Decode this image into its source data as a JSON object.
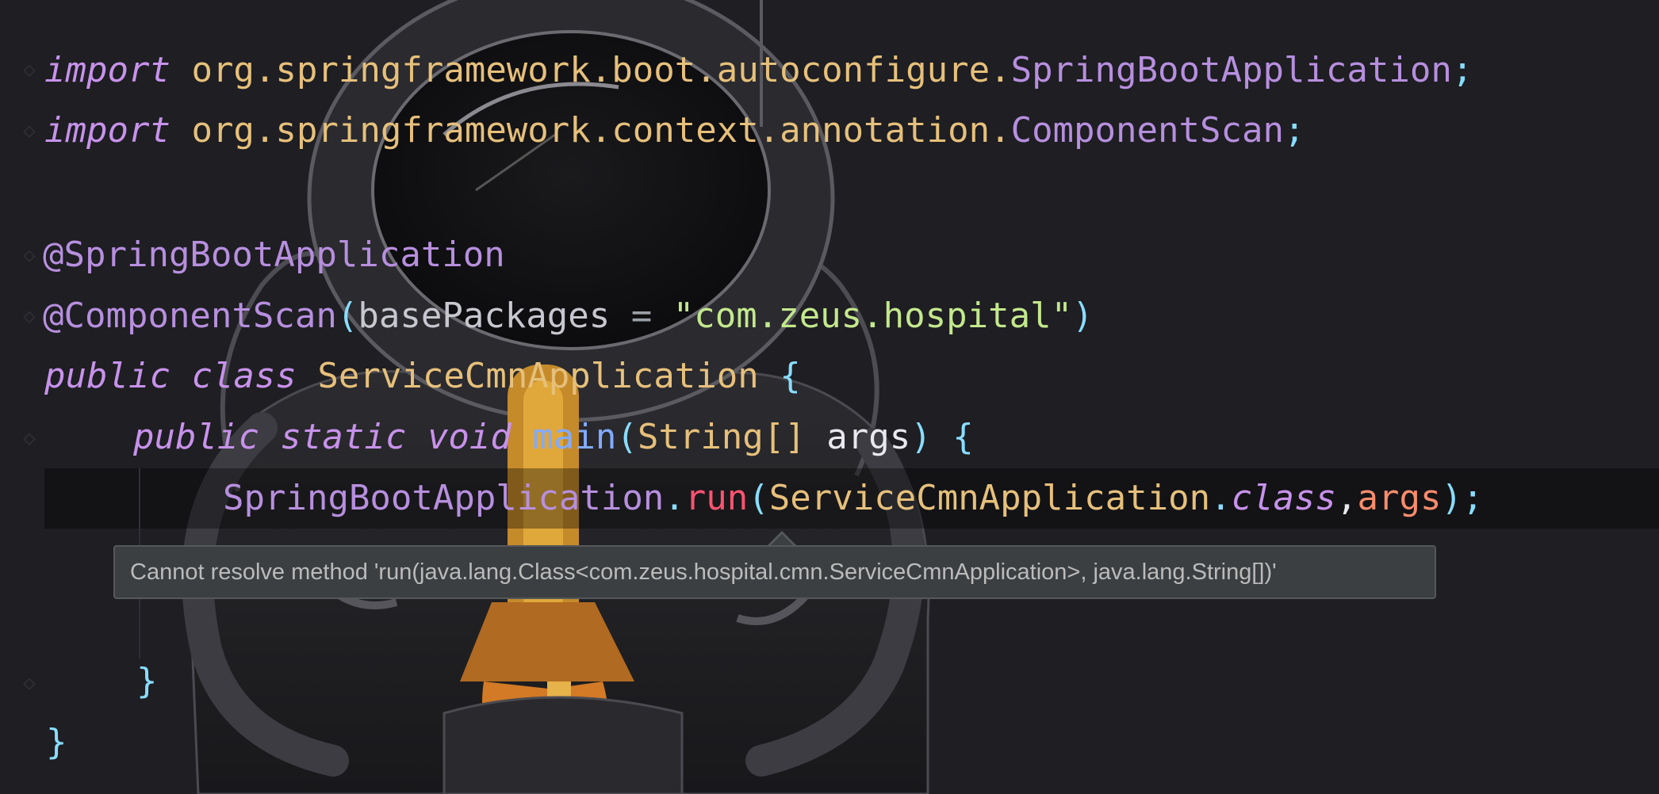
{
  "editor": {
    "language": "java",
    "background_color": "#1e1e23",
    "background_image": "astronaut-holding-rocket-artwork",
    "lines": {
      "l1": {
        "kw": "import",
        "pkg": "org.springframework.boot.autoconfigure.",
        "cls": "SpringBootApplication",
        "end": ";"
      },
      "l2": {
        "kw": "import",
        "pkg": "org.springframework.context.annotation.",
        "cls": "ComponentScan",
        "end": ";"
      },
      "l4": {
        "ann": "@SpringBootApplication"
      },
      "l5": {
        "ann": "@ComponentScan",
        "open": "(",
        "param": "basePackages",
        "eq": " = ",
        "str": "\"com.zeus.hospital\"",
        "close": ")"
      },
      "l6": {
        "kw1": "public",
        "kw2": "class",
        "cls": "ServiceCmnApplication",
        "brace": "{"
      },
      "l7": {
        "kw1": "public",
        "kw2": "static",
        "kw3": "void",
        "meth": "main",
        "open": "(",
        "type": "String[]",
        "param": "args",
        "close": ")",
        "brace": "{"
      },
      "l8": {
        "cls": "SpringBootApplication",
        "dot": ".",
        "meth": "run",
        "open": "(",
        "cls2": "ServiceCmnApplication",
        "dot2": ".",
        "kw": "class",
        "comma": ",",
        "args": "args",
        "close": ");"
      },
      "l11": {
        "brace": "}"
      },
      "l12": {
        "brace": "}"
      }
    }
  },
  "tooltip": {
    "message": "Cannot resolve method 'run(java.lang.Class<com.zeus.hospital.cmn.ServiceCmnApplication>, java.lang.String[])'"
  },
  "colors": {
    "keyword": "#c792ea",
    "class": "#e6c07b",
    "annotation": "#b78fde",
    "string": "#c3e88d",
    "error": "#ff5370",
    "tooltip_bg": "#3c3f41"
  }
}
